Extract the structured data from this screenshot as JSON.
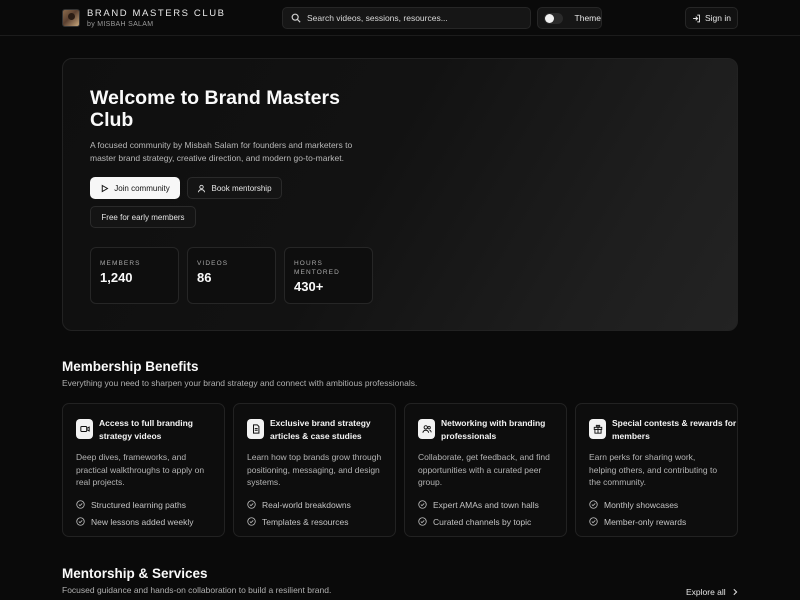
{
  "header": {
    "brand_title": "BRAND MASTERS CLUB",
    "brand_sub": "by MISBAH SALAM",
    "search_placeholder": "Search videos, sessions, resources...",
    "theme_label": "Theme",
    "signin_label": "Sign in"
  },
  "hero": {
    "title": "Welcome to Brand Masters Club",
    "description": "A focused community by Misbah Salam for founders and marketers to master brand strategy, creative direction, and modern go-to-market.",
    "join_label": "Join community",
    "book_label": "Book mentorship",
    "free_label": "Free for early members",
    "stats": [
      {
        "label": "MEMBERS",
        "value": "1,240"
      },
      {
        "label": "VIDEOS",
        "value": "86"
      },
      {
        "label": "HOURS MENTORED",
        "value": "430+"
      }
    ]
  },
  "benefits": {
    "title": "Membership Benefits",
    "subtitle": "Everything you need to sharpen your brand strategy and connect with ambitious professionals.",
    "cards": [
      {
        "icon": "video-icon",
        "title": "Access to full branding strategy videos",
        "description": "Deep dives, frameworks, and practical walkthroughs to apply on real projects.",
        "items": [
          "Structured learning paths",
          "New lessons added weekly"
        ]
      },
      {
        "icon": "document-icon",
        "title": "Exclusive brand strategy articles & case studies",
        "description": "Learn how top brands grow through positioning, messaging, and design systems.",
        "items": [
          "Real-world breakdowns",
          "Templates & resources"
        ]
      },
      {
        "icon": "users-icon",
        "title": "Networking with branding professionals",
        "description": "Collaborate, get feedback, and find opportunities with a curated peer group.",
        "items": [
          "Expert AMAs and town halls",
          "Curated channels by topic"
        ]
      },
      {
        "icon": "gift-icon",
        "title": "Special contests & rewards for members",
        "description": "Earn perks for sharing work, helping others, and contributing to the community.",
        "items": [
          "Monthly showcases",
          "Member-only rewards"
        ]
      }
    ]
  },
  "mentorship": {
    "title": "Mentorship & Services",
    "subtitle": "Focused guidance and hands-on collaboration to build a resilient brand.",
    "explore_label": "Explore all"
  }
}
